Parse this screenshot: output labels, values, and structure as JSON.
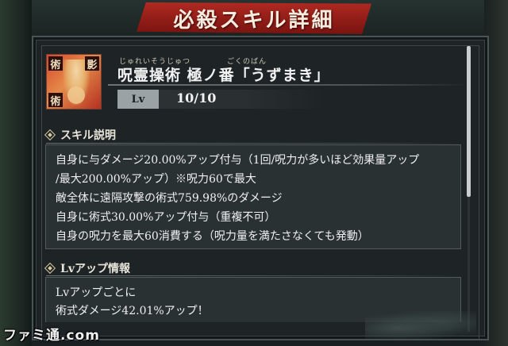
{
  "header": {
    "title": "必殺スキル詳細"
  },
  "skill": {
    "icon_tags": {
      "top_left": "術",
      "top_right": "影",
      "bottom_left": "術"
    },
    "ruby_left": "じゅれいそうじゅつ",
    "ruby_right": "ごくのばん",
    "name": "呪霊操術 極ノ番「うずまき」",
    "lv_label": "Lv",
    "lv_value": "10/10"
  },
  "sections": {
    "description": {
      "heading": "スキル説明",
      "lines": [
        "自身に与ダメージ20.00%アップ付与（1回/呪力が多いほど効果量アップ",
        "/最大200.00%アップ）※呪力60で最大",
        "敵全体に遠隔攻撃の術式759.98%のダメージ",
        "自身に術式30.00%アップ付与（重複不可）",
        "自身の呪力を最大60消費する（呪力量を満たさなくても発動）"
      ]
    },
    "lvup": {
      "heading": "Lvアップ情報",
      "lines": [
        "Lvアップごとに",
        "術式ダメージ42.01%アップ！"
      ]
    }
  },
  "watermark": "ファミ通.com"
}
